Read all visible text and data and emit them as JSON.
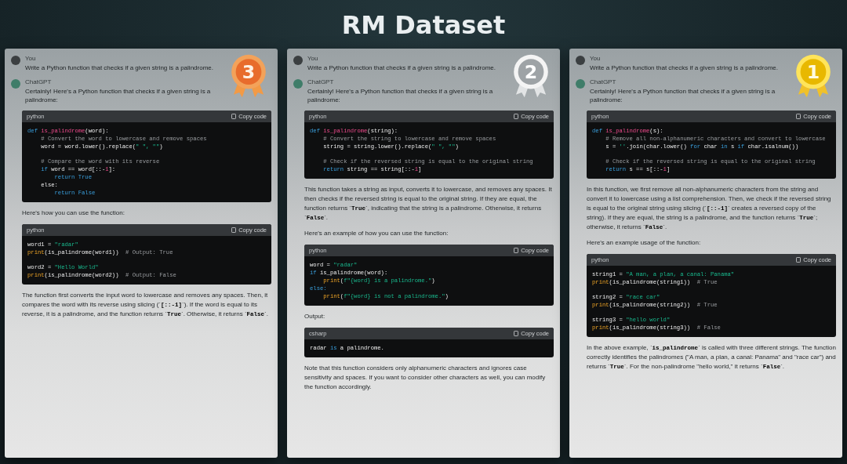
{
  "title": "RM Dataset",
  "cards": [
    {
      "medal": {
        "kind": "bronze",
        "rank": "3"
      },
      "user": "You",
      "prompt": "Write a Python function that checks if a given string is a palindrome.",
      "assistant": "ChatGPT",
      "reply": "Certainly! Here's a Python function that checks if a given string is a palindrome:",
      "blocks": [
        {
          "kind": "code",
          "lang": "python",
          "copy": "Copy code",
          "groups": [
            [
              [
                {
                  "text": "def ",
                  "kind": "kw"
                },
                {
                  "text": "is_palindrome",
                  "kind": "fn"
                },
                {
                  "text": "(word):",
                  "kind": "id"
                }
              ],
              [
                {
                  "text": "    # Convert the word to lowercase and remove spaces",
                  "kind": "cm"
                }
              ],
              [
                {
                  "text": "    word = word.lower().replace(",
                  "kind": "id"
                },
                {
                  "text": "\" \", \"\"",
                  "kind": "str"
                },
                {
                  "text": ")",
                  "kind": "id"
                }
              ]
            ],
            [
              [
                {
                  "text": "    # Compare the word with its reverse",
                  "kind": "cm"
                }
              ],
              [
                {
                  "text": "    if ",
                  "kind": "kw"
                },
                {
                  "text": "word == word[::-",
                  "kind": "id"
                },
                {
                  "text": "1",
                  "kind": "num"
                },
                {
                  "text": "]:",
                  "kind": "id"
                }
              ],
              [
                {
                  "text": "        return True",
                  "kind": "kw"
                }
              ],
              [
                {
                  "text": "    else:",
                  "kind": "id"
                }
              ],
              [
                {
                  "text": "        return False",
                  "kind": "kw"
                }
              ]
            ]
          ]
        },
        {
          "kind": "text",
          "text": "Here's how you can use the function:"
        },
        {
          "kind": "code",
          "lang": "python",
          "copy": "Copy code",
          "groups": [
            [
              [
                {
                  "text": "word1 = ",
                  "kind": "id"
                },
                {
                  "text": "\"radar\"",
                  "kind": "str"
                }
              ],
              [
                {
                  "text": "print",
                  "kind": "bi"
                },
                {
                  "text": "(is_palindrome(word1))  ",
                  "kind": "id"
                },
                {
                  "text": "# Output: True",
                  "kind": "cm"
                }
              ]
            ],
            [
              [
                {
                  "text": "word2 = ",
                  "kind": "id"
                },
                {
                  "text": "\"Hello World\"",
                  "kind": "str"
                }
              ],
              [
                {
                  "text": "print",
                  "kind": "bi"
                },
                {
                  "text": "(is_palindrome(word2))  ",
                  "kind": "id"
                },
                {
                  "text": "# Output: False",
                  "kind": "cm"
                }
              ]
            ]
          ]
        },
        {
          "kind": "text",
          "text": "The function first converts the input word to lowercase and removes any spaces. Then, it compares the word with its reverse using slicing (`**[::-1]**`). If the word is equal to its reverse, it is a palindrome, and the function returns `**True**`. Otherwise, it returns `**False**`."
        }
      ]
    },
    {
      "medal": {
        "kind": "silver",
        "rank": "2"
      },
      "user": "You",
      "prompt": "Write a Python function that checks if a given string is a palindrome.",
      "assistant": "ChatGPT",
      "reply": "Certainly! Here's a Python function that checks if a given string is a palindrome:",
      "blocks": [
        {
          "kind": "code",
          "lang": "python",
          "copy": "Copy code",
          "groups": [
            [
              [
                {
                  "text": "def ",
                  "kind": "kw"
                },
                {
                  "text": "is_palindrome",
                  "kind": "fn"
                },
                {
                  "text": "(string):",
                  "kind": "id"
                }
              ],
              [
                {
                  "text": "    # Convert the string to lowercase and remove spaces",
                  "kind": "cm"
                }
              ],
              [
                {
                  "text": "    string = string.lower().replace(",
                  "kind": "id"
                },
                {
                  "text": "\" \", \"\"",
                  "kind": "str"
                },
                {
                  "text": ")",
                  "kind": "id"
                }
              ]
            ],
            [
              [
                {
                  "text": "    # Check if the reversed string is equal to the original string",
                  "kind": "cm"
                }
              ],
              [
                {
                  "text": "    return ",
                  "kind": "kw"
                },
                {
                  "text": "string == string[::-",
                  "kind": "id"
                },
                {
                  "text": "1",
                  "kind": "num"
                },
                {
                  "text": "]",
                  "kind": "id"
                }
              ]
            ]
          ]
        },
        {
          "kind": "text",
          "text": "This function takes a string as input, converts it to lowercase, and removes any spaces. It then checks if the reversed string is equal to the original string. If they are equal, the function returns `**True**`, indicating that the string is a palindrome. Otherwise, it returns `**False**`."
        },
        {
          "kind": "text",
          "text": "Here's an example of how you can use the function:"
        },
        {
          "kind": "code",
          "lang": "python",
          "copy": "Copy code",
          "groups": [
            [
              [
                {
                  "text": "word = ",
                  "kind": "id"
                },
                {
                  "text": "\"radar\"",
                  "kind": "str"
                }
              ],
              [
                {
                  "text": "if ",
                  "kind": "kw"
                },
                {
                  "text": "is_palindrome(word):",
                  "kind": "id"
                }
              ],
              [
                {
                  "text": "    print",
                  "kind": "bi"
                },
                {
                  "text": "(",
                  "kind": "id"
                },
                {
                  "text": "f\"{word} is a palindrome.\"",
                  "kind": "str"
                },
                {
                  "text": ")",
                  "kind": "id"
                }
              ],
              [
                {
                  "text": "else:",
                  "kind": "kw"
                }
              ],
              [
                {
                  "text": "    print",
                  "kind": "bi"
                },
                {
                  "text": "(",
                  "kind": "id"
                },
                {
                  "text": "f\"{word} is not a palindrome.\"",
                  "kind": "str"
                },
                {
                  "text": ")",
                  "kind": "id"
                }
              ]
            ]
          ]
        },
        {
          "kind": "text",
          "text": "Output:"
        },
        {
          "kind": "code",
          "lang": "csharp",
          "copy": "Copy code",
          "groups": [
            [
              [
                {
                  "text": "radar ",
                  "kind": "id"
                },
                {
                  "text": "is",
                  "kind": "kw"
                },
                {
                  "text": " a palindrome.",
                  "kind": "id"
                }
              ]
            ]
          ]
        },
        {
          "kind": "text",
          "text": "Note that this function considers only alphanumeric characters and ignores case sensitivity and spaces. If you want to consider other characters as well, you can modify the function accordingly."
        }
      ]
    },
    {
      "medal": {
        "kind": "gold",
        "rank": "1"
      },
      "user": "You",
      "prompt": "Write a Python function that checks if a given string is a palindrome.",
      "assistant": "ChatGPT",
      "reply": "Certainly! Here's a Python function that checks if a given string is a palindrome:",
      "blocks": [
        {
          "kind": "code",
          "lang": "python",
          "copy": "Copy code",
          "groups": [
            [
              [
                {
                  "text": "def ",
                  "kind": "kw"
                },
                {
                  "text": "is_palindrome",
                  "kind": "fn"
                },
                {
                  "text": "(s):",
                  "kind": "id"
                }
              ],
              [
                {
                  "text": "    # Remove all non-alphanumeric characters and convert to lowercase",
                  "kind": "cm"
                }
              ],
              [
                {
                  "text": "    s = ",
                  "kind": "id"
                },
                {
                  "text": "''",
                  "kind": "str"
                },
                {
                  "text": ".join(char.lower() ",
                  "kind": "id"
                },
                {
                  "text": "for ",
                  "kind": "kw"
                },
                {
                  "text": "char ",
                  "kind": "id"
                },
                {
                  "text": "in ",
                  "kind": "kw"
                },
                {
                  "text": "s ",
                  "kind": "id"
                },
                {
                  "text": "if ",
                  "kind": "kw"
                },
                {
                  "text": "char.isalnum())",
                  "kind": "id"
                }
              ]
            ],
            [
              [
                {
                  "text": "    # Check if the reversed string is equal to the original string",
                  "kind": "cm"
                }
              ],
              [
                {
                  "text": "    return ",
                  "kind": "kw"
                },
                {
                  "text": "s == s[::-",
                  "kind": "id"
                },
                {
                  "text": "1",
                  "kind": "num"
                },
                {
                  "text": "]",
                  "kind": "id"
                }
              ]
            ]
          ]
        },
        {
          "kind": "text",
          "text": "In this function, we first remove all non-alphanumeric characters from the string and convert it to lowercase using a list comprehension. Then, we check if the reversed string is equal to the original string using slicing (`**[::-1]**` creates a reversed copy of the string). If they are equal, the string is a palindrome, and the function returns `**True**`; otherwise, it returns `**False**`."
        },
        {
          "kind": "text",
          "text": "Here's an example usage of the function:"
        },
        {
          "kind": "code",
          "lang": "python",
          "copy": "Copy code",
          "groups": [
            [
              [
                {
                  "text": "string1 = ",
                  "kind": "id"
                },
                {
                  "text": "\"A man, a plan, a canal: Panama\"",
                  "kind": "str"
                }
              ],
              [
                {
                  "text": "print",
                  "kind": "bi"
                },
                {
                  "text": "(is_palindrome(string1))  ",
                  "kind": "id"
                },
                {
                  "text": "# True",
                  "kind": "cm"
                }
              ]
            ],
            [
              [
                {
                  "text": "string2 = ",
                  "kind": "id"
                },
                {
                  "text": "\"race car\"",
                  "kind": "str"
                }
              ],
              [
                {
                  "text": "print",
                  "kind": "bi"
                },
                {
                  "text": "(is_palindrome(string2))  ",
                  "kind": "id"
                },
                {
                  "text": "# True",
                  "kind": "cm"
                }
              ]
            ],
            [
              [
                {
                  "text": "string3 = ",
                  "kind": "id"
                },
                {
                  "text": "\"hello world\"",
                  "kind": "str"
                }
              ],
              [
                {
                  "text": "print",
                  "kind": "bi"
                },
                {
                  "text": "(is_palindrome(string3))  ",
                  "kind": "id"
                },
                {
                  "text": "# False",
                  "kind": "cm"
                }
              ]
            ]
          ]
        },
        {
          "kind": "text",
          "text": "In the above example, `**is_palindrome**` is called with three different strings. The function correctly identifies the palindromes (\"A man, a plan, a canal: Panama\" and \"race car\") and returns `**True**`. For the non-palindrome \"hello world,\" it returns `**False**`."
        }
      ]
    }
  ]
}
